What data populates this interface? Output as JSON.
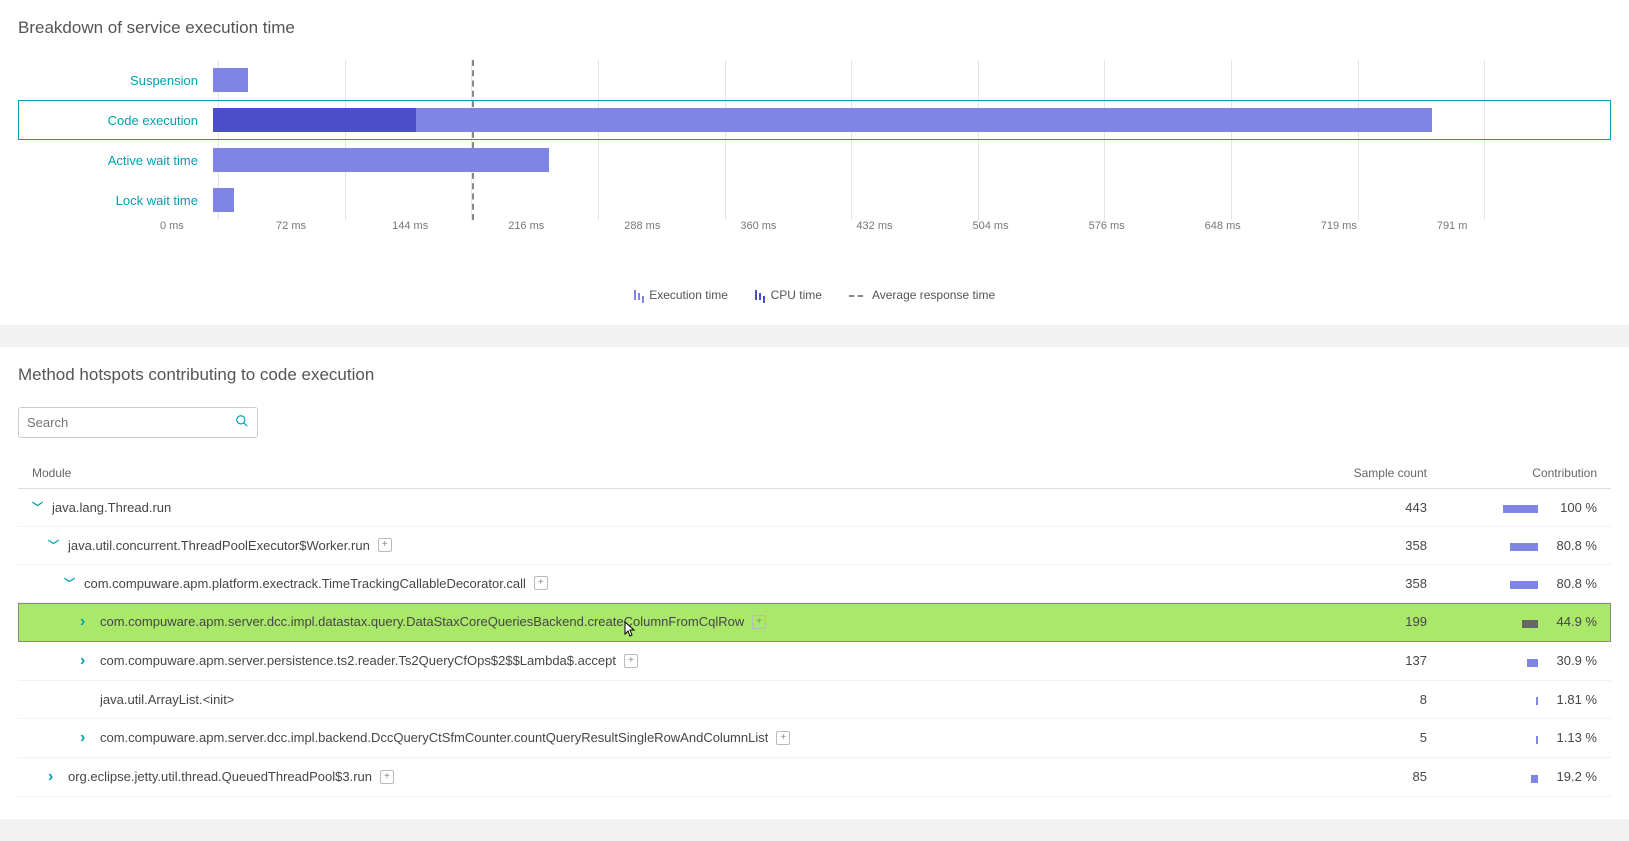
{
  "breakdown": {
    "title": "Breakdown of service execution time",
    "avg_line_ms": 144,
    "legend": {
      "exec": "Execution time",
      "cpu": "CPU time",
      "avg": "Average response time"
    }
  },
  "chart_data": {
    "type": "bar",
    "xlabel": "ms",
    "xmax": 791,
    "xticks": [
      "0 ms",
      "72 ms",
      "144 ms",
      "216 ms",
      "288 ms",
      "360 ms",
      "432 ms",
      "504 ms",
      "576 ms",
      "648 ms",
      "719 ms",
      "791 m"
    ],
    "avg_response_time_ms": 144,
    "series": [
      {
        "name": "Execution time",
        "color": "#7e85e3"
      },
      {
        "name": "CPU time",
        "color": "#4a4fc9"
      }
    ],
    "categories": [
      "Suspension",
      "Code execution",
      "Active wait time",
      "Lock wait time"
    ],
    "rows": [
      {
        "label": "Suspension",
        "exec_ms": 20,
        "cpu_ms": 0,
        "selected": false
      },
      {
        "label": "Code execution",
        "exec_ms": 690,
        "cpu_ms": 115,
        "selected": true
      },
      {
        "label": "Active wait time",
        "exec_ms": 190,
        "cpu_ms": 0,
        "selected": false
      },
      {
        "label": "Lock wait time",
        "exec_ms": 12,
        "cpu_ms": 0,
        "selected": false
      }
    ]
  },
  "hotspots": {
    "title": "Method hotspots contributing to code execution",
    "search_placeholder": "Search",
    "columns": {
      "module": "Module",
      "sample": "Sample count",
      "contrib": "Contribution"
    },
    "rows": [
      {
        "indent": 0,
        "chev": "down",
        "name": "java.lang.Thread.run",
        "plus": false,
        "sample": 443,
        "pct": 100,
        "highlight": false
      },
      {
        "indent": 1,
        "chev": "down",
        "name": "java.util.concurrent.ThreadPoolExecutor$Worker.run",
        "plus": true,
        "sample": 358,
        "pct": 80.8,
        "highlight": false
      },
      {
        "indent": 2,
        "chev": "down",
        "name": "com.compuware.apm.platform.exectrack.TimeTrackingCallableDecorator.call",
        "plus": true,
        "sample": 358,
        "pct": 80.8,
        "highlight": false
      },
      {
        "indent": 3,
        "chev": "right",
        "name": "com.compuware.apm.server.dcc.impl.datastax.query.DataStaxCoreQueriesBackend.createColumnFromCqlRow",
        "plus": true,
        "sample": 199,
        "pct": 44.9,
        "highlight": true,
        "cursor": true
      },
      {
        "indent": 3,
        "chev": "right",
        "name": "com.compuware.apm.server.persistence.ts2.reader.Ts2QueryCfOps$2$$Lambda$.accept",
        "plus": true,
        "sample": 137,
        "pct": 30.9,
        "highlight": false
      },
      {
        "indent": 3,
        "chev": "none",
        "name": "java.util.ArrayList.<init>",
        "plus": false,
        "sample": 8,
        "pct": 1.81,
        "highlight": false
      },
      {
        "indent": 3,
        "chev": "right",
        "name": "com.compuware.apm.server.dcc.impl.backend.DccQueryCtSfmCounter.countQueryResultSingleRowAndColumnList",
        "plus": true,
        "sample": 5,
        "pct": 1.13,
        "highlight": false
      },
      {
        "indent": 1,
        "chev": "right",
        "name": "org.eclipse.jetty.util.thread.QueuedThreadPool$3.run",
        "plus": true,
        "sample": 85,
        "pct": 19.2,
        "highlight": false
      }
    ]
  }
}
